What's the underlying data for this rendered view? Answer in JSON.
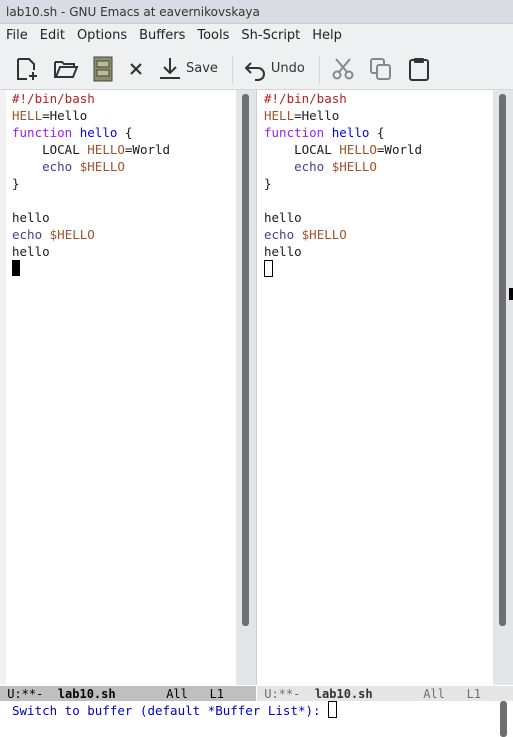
{
  "window": {
    "title": "lab10.sh - GNU Emacs at eavernikovskaya"
  },
  "menu": [
    "File",
    "Edit",
    "Options",
    "Buffers",
    "Tools",
    "Sh-Script",
    "Help"
  ],
  "toolbar": {
    "new_file": "new-file-icon",
    "open": "open-folder-icon",
    "dired": "file-cabinet-icon",
    "close": "close-icon",
    "save_label": "Save",
    "undo_label": "Undo",
    "cut": "scissors-icon",
    "copy": "copy-icon",
    "paste": "clipboard-icon"
  },
  "editor": {
    "line1": "#!/bin/bash",
    "l2_var": "HELL",
    "l2_rest": "=Hello",
    "l3_kw": "function",
    "l3_fn": "hello",
    "l3_rest": " {",
    "l4_cmd": "LOCAL ",
    "l4_var": "HELLO",
    "l4_rest": "=World",
    "l5_bi": "echo",
    "l5_var": "$HELLO",
    "l6": "}",
    "l8": "hello",
    "l9_bi": "echo",
    "l9_var": "$HELLO",
    "l10": "hello"
  },
  "modeline_left": {
    "status": "U:**-",
    "buffer": "lab10.sh",
    "pos": "All",
    "line": "L1"
  },
  "modeline_right": {
    "status": "U:**-",
    "buffer": "lab10.sh",
    "pos": "All",
    "line": "L1"
  },
  "minibuffer": {
    "prompt": "Switch to buffer (default *Buffer List*): "
  }
}
